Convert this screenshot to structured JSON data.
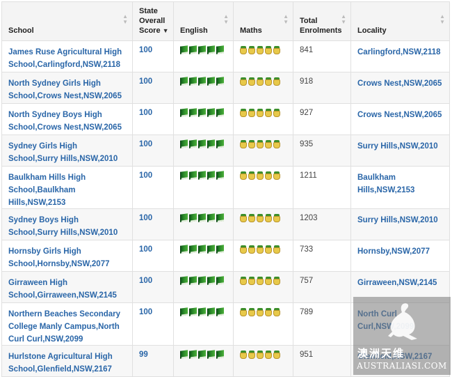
{
  "columns": {
    "school": "School",
    "score": "State Overall Score",
    "english": "English",
    "maths": "Maths",
    "enrolments": "Total Enrolments",
    "locality": "Locality"
  },
  "icons": {
    "english": "book-icon",
    "maths": "pineapple-icon",
    "english_count": 5,
    "maths_count": 5
  },
  "rows": [
    {
      "school": "James Ruse Agricultural High School,Carlingford,NSW,2118",
      "score": "100",
      "enrolments": "841",
      "locality": "Carlingford,NSW,2118"
    },
    {
      "school": "North Sydney Girls High School,Crows Nest,NSW,2065",
      "score": "100",
      "enrolments": "918",
      "locality": "Crows Nest,NSW,2065"
    },
    {
      "school": "North Sydney Boys High School,Crows Nest,NSW,2065",
      "score": "100",
      "enrolments": "927",
      "locality": "Crows Nest,NSW,2065"
    },
    {
      "school": "Sydney Girls High School,Surry Hills,NSW,2010",
      "score": "100",
      "enrolments": "935",
      "locality": "Surry Hills,NSW,2010"
    },
    {
      "school": "Baulkham Hills High School,Baulkham Hills,NSW,2153",
      "score": "100",
      "enrolments": "1211",
      "locality": "Baulkham Hills,NSW,2153"
    },
    {
      "school": "Sydney Boys High School,Surry Hills,NSW,2010",
      "score": "100",
      "enrolments": "1203",
      "locality": "Surry Hills,NSW,2010"
    },
    {
      "school": "Hornsby Girls High School,Hornsby,NSW,2077",
      "score": "100",
      "enrolments": "733",
      "locality": "Hornsby,NSW,2077"
    },
    {
      "school": "Girraween High School,Girraween,NSW,2145",
      "score": "100",
      "enrolments": "757",
      "locality": "Girraween,NSW,2145"
    },
    {
      "school": "Northern Beaches Secondary College Manly Campus,North Curl Curl,NSW,2099",
      "score": "100",
      "enrolments": "789",
      "locality": "North Curl Curl,NSW,2099"
    },
    {
      "school": "Hurlstone Agricultural High School,Glenfield,NSW,2167",
      "score": "99",
      "enrolments": "951",
      "locality": "Glenfield,NSW,2167"
    }
  ],
  "watermark": {
    "cn": "澳洲天维",
    "en": "AUSTRALIASI.COM"
  },
  "colors": {
    "link": "#2a66a8",
    "header_bg": "#f4f4f4",
    "border": "#e0e0e0"
  }
}
